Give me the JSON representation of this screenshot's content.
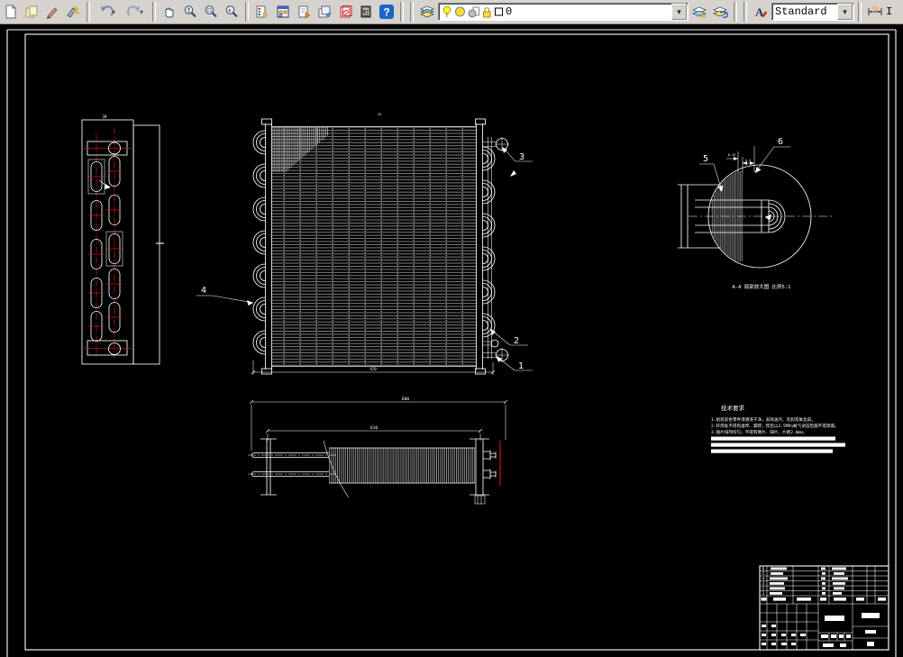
{
  "toolbar": {
    "layer_value": "0",
    "text_style_value": "Standard",
    "dim_style_value": "I",
    "icons": [
      "new",
      "copy",
      "pencil",
      "match-properties",
      "undo",
      "redo",
      "pan",
      "zoom-realtime",
      "zoom-window",
      "zoom-previous",
      "properties",
      "design-center",
      "tool-palettes",
      "sheet-set-manager",
      "markup-set-manager",
      "quick-calc",
      "help",
      "layers",
      "layer-on-bulb",
      "layer-freeze",
      "layer-vp-freeze",
      "layer-lock",
      "layer-color-swatch",
      "layer-states",
      "layer-previous",
      "text-style",
      "dim-style"
    ]
  },
  "drawing": {
    "balloons": [
      "1",
      "2",
      "3",
      "4",
      "5",
      "6"
    ],
    "bom": [
      "6",
      "5",
      "4",
      "3",
      "2",
      "1"
    ],
    "dims": {
      "left_width": "20",
      "front_top": "25",
      "front_bottom": "470",
      "bottom_overall": "680",
      "bottom_fins": "610",
      "fin_thickness": "0.15",
      "fin_pitch": "2.2"
    },
    "detail_caption": "A-A 局部放大图 比例5:1",
    "notes": {
      "title": "技术要求",
      "lines": [
        "1.组装前各零件须清洗干净，去除油污、毛刺及氧化皮。",
        "2.钎焊处不得有虚焊、漏焊，焊后以2.5MPa氮气试压检漏不得渗漏。",
        "3.翅片排列均匀，不得有倒片、缺片，片距2.0mm。"
      ]
    }
  }
}
